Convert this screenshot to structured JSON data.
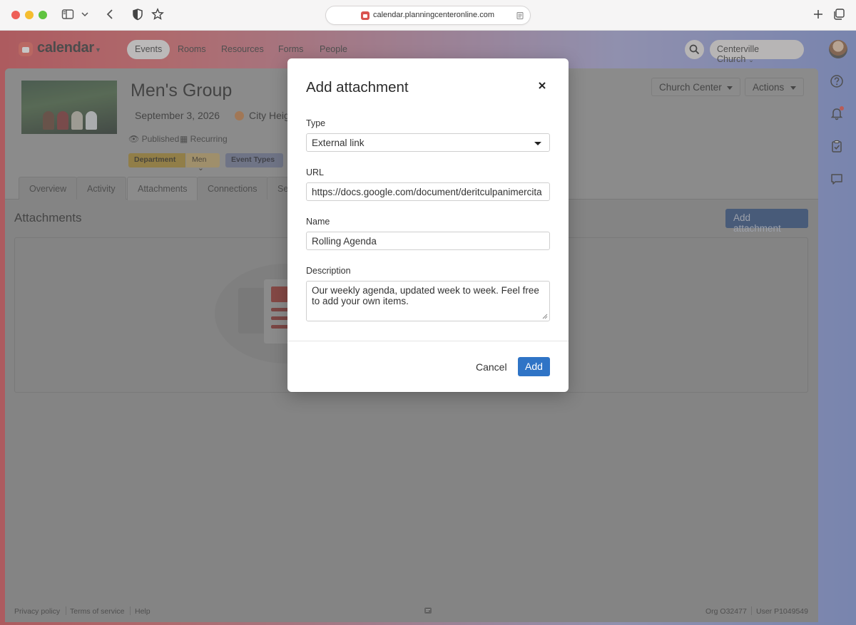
{
  "browser": {
    "url": "calendar.planningcenteronline.com"
  },
  "topnav": {
    "app_name": "calendar",
    "links": [
      "Events",
      "Rooms",
      "Resources",
      "Forms",
      "People"
    ],
    "active_link": "Events",
    "org_name": "Centerville Church"
  },
  "event": {
    "title": "Men's Group",
    "date": "September 3, 2026",
    "location": "City Heig",
    "status_published": "Published",
    "status_recurring": "Recurring",
    "tag_department": "Department",
    "tag_men": "Men",
    "tag_event_types": "Event Types",
    "header_button_church_center": "Church Center",
    "header_button_actions": "Actions"
  },
  "tabs": [
    "Overview",
    "Activity",
    "Attachments",
    "Connections",
    "Se"
  ],
  "active_tab": "Attachments",
  "attachments": {
    "section_title": "Attachments",
    "add_button": "Add attachment"
  },
  "footer": {
    "privacy": "Privacy policy",
    "terms": "Terms of service",
    "help": "Help",
    "org": "Org O32477",
    "user": "User P1049549"
  },
  "modal": {
    "title": "Add attachment",
    "type_label": "Type",
    "type_value": "External link",
    "url_label": "URL",
    "url_value": "https://docs.google.com/document/deritculpanimercita",
    "name_label": "Name",
    "name_value": "Rolling Agenda",
    "description_label": "Description",
    "description_value": "Our weekly agenda, updated week to week. Feel free to add your own items.",
    "cancel_label": "Cancel",
    "add_label": "Add"
  },
  "colors": {
    "primary_button": "#2f74c6",
    "brand": "#e95d54"
  }
}
